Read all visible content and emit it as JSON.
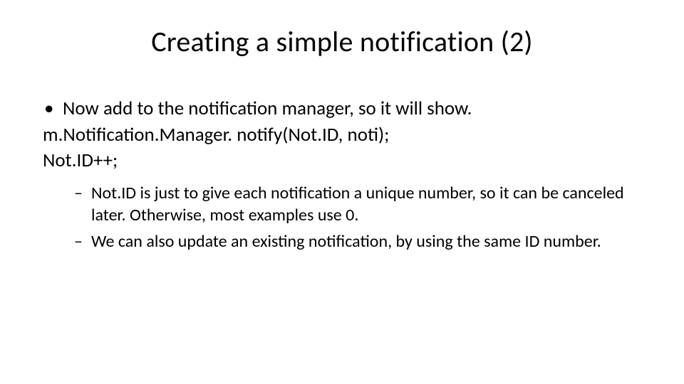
{
  "title": "Creating a simple notification (2)",
  "bullet1": "Now add to the notification manager, so it will show.",
  "code1": "m.Notification.Manager. notify(Not.ID, noti);",
  "code2": "Not.ID++;",
  "sub1": "Not.ID is just to give each notification a unique number, so it can be canceled later.  Otherwise, most examples use 0.",
  "sub2": "We can also update an existing notification, by using the same ID number.",
  "bullet_char": "•",
  "dash_char": "–"
}
